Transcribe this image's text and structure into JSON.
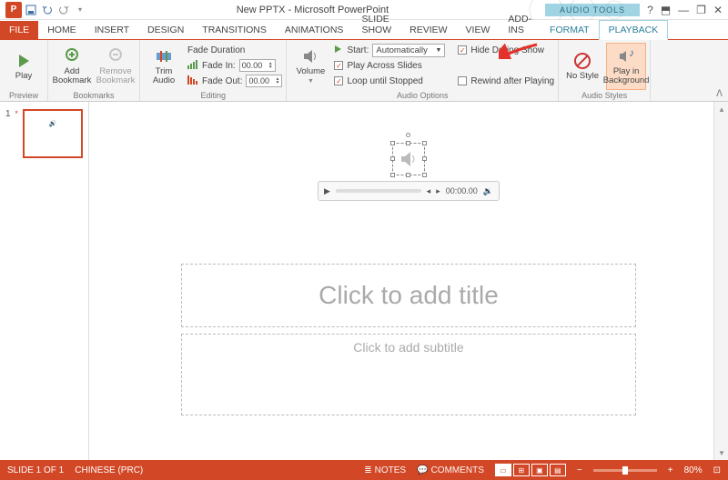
{
  "title": "New PPTX - Microsoft PowerPoint",
  "contextualGroup": "AUDIO TOOLS",
  "tabs": {
    "file": "FILE",
    "home": "HOME",
    "insert": "INSERT",
    "design": "DESIGN",
    "transitions": "TRANSITIONS",
    "animations": "ANIMATIONS",
    "slideshow": "SLIDE SHOW",
    "review": "REVIEW",
    "view": "VIEW",
    "addins": "ADD-INS",
    "format": "FORMAT",
    "playback": "PLAYBACK"
  },
  "ribbon": {
    "preview": {
      "play": "Play",
      "label": "Preview"
    },
    "bookmarks": {
      "add": "Add Bookmark",
      "remove": "Remove Bookmark",
      "label": "Bookmarks"
    },
    "editing": {
      "trim": "Trim Audio",
      "fadeDur": "Fade Duration",
      "fadeIn": "Fade In:",
      "fadeOut": "Fade Out:",
      "fadeInVal": "00.00",
      "fadeOutVal": "00.00",
      "label": "Editing"
    },
    "audioOptions": {
      "volume": "Volume",
      "start": "Start:",
      "startVal": "Automatically",
      "playAcross": "Play Across Slides",
      "loop": "Loop until Stopped",
      "hide": "Hide During Show",
      "rewind": "Rewind after Playing",
      "label": "Audio Options"
    },
    "audioStyles": {
      "noStyle": "No Style",
      "playBg": "Play in Background",
      "label": "Audio Styles"
    }
  },
  "slide": {
    "titlePlaceholder": "Click to add title",
    "subtitlePlaceholder": "Click to add subtitle"
  },
  "player": {
    "time": "00:00.00"
  },
  "status": {
    "slideOf": "SLIDE 1 OF 1",
    "lang": "CHINESE (PRC)",
    "notes": "NOTES",
    "comments": "COMMENTS",
    "zoom": "80%"
  },
  "thumb": {
    "num": "1",
    "star": "*"
  }
}
